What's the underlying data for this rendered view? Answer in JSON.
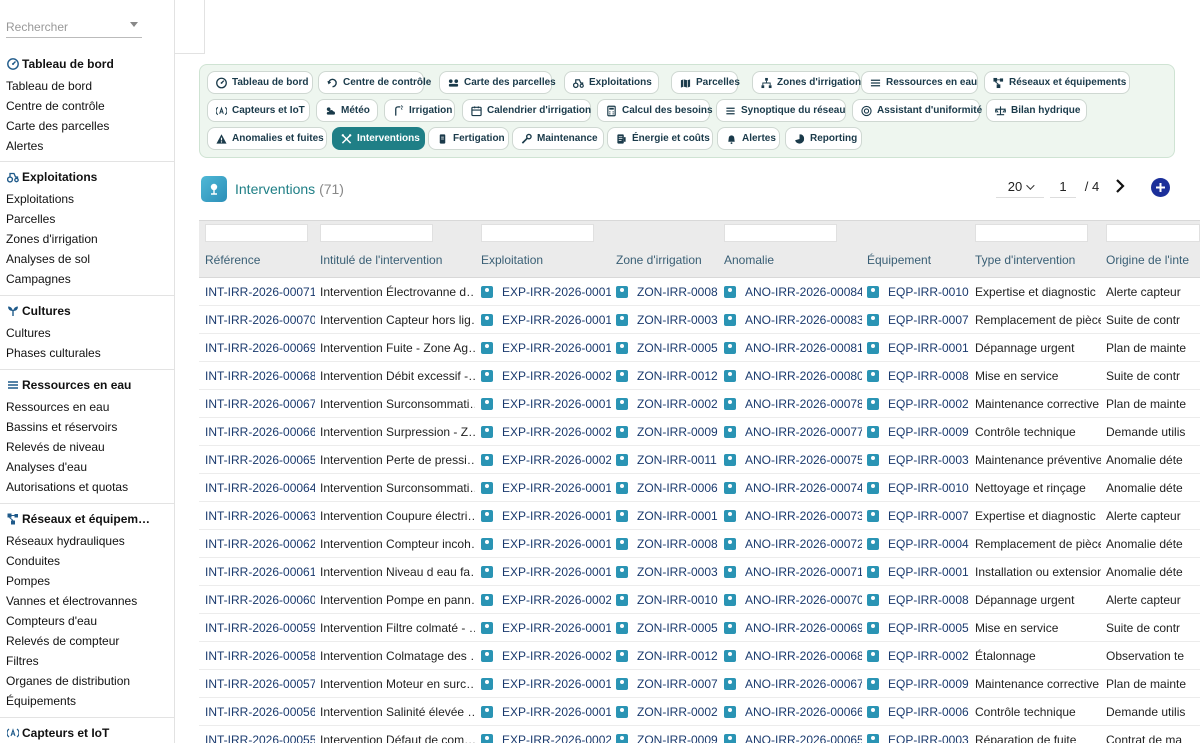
{
  "sidebar": {
    "search_placeholder": "Rechercher",
    "groups": [
      {
        "title": "Tableau de bord",
        "icon": "dashboard-icon",
        "items": [
          "Tableau de bord",
          "Centre de contrôle",
          "Carte des parcelles",
          "Alertes"
        ]
      },
      {
        "title": "Exploitations",
        "icon": "tractor-icon",
        "items": [
          "Exploitations",
          "Parcelles",
          "Zones d'irrigation",
          "Analyses de sol",
          "Campagnes"
        ]
      },
      {
        "title": "Cultures",
        "icon": "sprout-icon",
        "items": [
          "Cultures",
          "Phases culturales"
        ]
      },
      {
        "title": "Ressources en eau",
        "icon": "water-icon",
        "items": [
          "Ressources en eau",
          "Bassins et réservoirs",
          "Relevés de niveau",
          "Analyses d'eau",
          "Autorisations et quotas"
        ]
      },
      {
        "title": "Réseaux et équipem…",
        "icon": "network-icon",
        "items": [
          "Réseaux hydrauliques",
          "Conduites",
          "Pompes",
          "Vannes et électrovannes",
          "Compteurs d'eau",
          "Relevés de compteur",
          "Filtres",
          "Organes de distribution",
          "Équipements"
        ]
      },
      {
        "title": "Capteurs et IoT",
        "icon": "sensor-icon",
        "items": []
      }
    ]
  },
  "tabs": [
    {
      "label": "Tableau de bord",
      "icon": "dashboard-icon",
      "active": false
    },
    {
      "label": "Centre de contrôle",
      "icon": "control-icon",
      "active": false
    },
    {
      "label": "Carte des parcelles",
      "icon": "map-icon",
      "active": false
    },
    {
      "label": "Exploitations",
      "icon": "tractor-icon",
      "active": false
    },
    {
      "label": "Parcelles",
      "icon": "parcel-icon",
      "active": false
    },
    {
      "label": "Zones d'irrigation",
      "icon": "zones-icon",
      "active": false
    },
    {
      "label": "Ressources en eau",
      "icon": "water-icon",
      "active": false
    },
    {
      "label": "Réseaux et équipements",
      "icon": "network-icon",
      "active": false
    },
    {
      "label": "Capteurs et IoT",
      "icon": "sensor-icon",
      "active": false
    },
    {
      "label": "Météo",
      "icon": "weather-icon",
      "active": false
    },
    {
      "label": "Irrigation",
      "icon": "irrigation-icon",
      "active": false
    },
    {
      "label": "Calendrier d'irrigation",
      "icon": "calendar-icon",
      "active": false
    },
    {
      "label": "Calcul des besoins",
      "icon": "calculator-icon",
      "active": false
    },
    {
      "label": "Synoptique du réseau",
      "icon": "synoptic-icon",
      "active": false
    },
    {
      "label": "Assistant d'uniformité",
      "icon": "target-icon",
      "active": false
    },
    {
      "label": "Bilan hydrique",
      "icon": "balance-icon",
      "active": false
    },
    {
      "label": "Anomalies et fuites",
      "icon": "warning-icon",
      "active": false
    },
    {
      "label": "Interventions",
      "icon": "tools-icon",
      "active": true
    },
    {
      "label": "Fertigation",
      "icon": "fertigation-icon",
      "active": false
    },
    {
      "label": "Maintenance",
      "icon": "wrench-icon",
      "active": false
    },
    {
      "label": "Énergie et coûts",
      "icon": "energy-icon",
      "active": false
    },
    {
      "label": "Alertes",
      "icon": "bell-icon",
      "active": false
    },
    {
      "label": "Reporting",
      "icon": "report-icon",
      "active": false
    }
  ],
  "list": {
    "title": "Interventions",
    "count": "(71)",
    "page_size": "20",
    "page": "1",
    "page_of": "/  4"
  },
  "table": {
    "columns": [
      "Référence",
      "Intitulé de l'intervention",
      "Exploitation",
      "Zone d'irrigation",
      "Anomalie",
      "Équipement",
      "Type d'intervention",
      "Origine de l'inte"
    ],
    "rows": [
      [
        "INT-IRR-2026-00071",
        "Intervention Électrovanne d…",
        "EXP-IRR-2026-0001",
        "ZON-IRR-0008",
        "ANO-IRR-2026-00084",
        "EQP-IRR-0010",
        "Expertise et diagnostic",
        "Alerte capteur"
      ],
      [
        "INT-IRR-2026-00070",
        "Intervention Capteur hors lig…",
        "EXP-IRR-2026-0001",
        "ZON-IRR-0003",
        "ANO-IRR-2026-00083",
        "EQP-IRR-0007",
        "Remplacement de pièce",
        "Suite de contr"
      ],
      [
        "INT-IRR-2026-00069",
        "Intervention Fuite - Zone Ag…",
        "EXP-IRR-2026-0001",
        "ZON-IRR-0005",
        "ANO-IRR-2026-00081",
        "EQP-IRR-0001",
        "Dépannage urgent",
        "Plan de mainte"
      ],
      [
        "INT-IRR-2026-00068",
        "Intervention Débit excessif -…",
        "EXP-IRR-2026-0002",
        "ZON-IRR-0012",
        "ANO-IRR-2026-00080",
        "EQP-IRR-0008",
        "Mise en service",
        "Suite de contr"
      ],
      [
        "INT-IRR-2026-00067",
        "Intervention Surconsommati…",
        "EXP-IRR-2026-0001",
        "ZON-IRR-0002",
        "ANO-IRR-2026-00078",
        "EQP-IRR-0002",
        "Maintenance corrective",
        "Plan de mainte"
      ],
      [
        "INT-IRR-2026-00066",
        "Intervention Surpression - Z…",
        "EXP-IRR-2026-0002",
        "ZON-IRR-0009",
        "ANO-IRR-2026-00077",
        "EQP-IRR-0009",
        "Contrôle technique",
        "Demande utilis"
      ],
      [
        "INT-IRR-2026-00065",
        "Intervention Perte de pressi…",
        "EXP-IRR-2026-0002",
        "ZON-IRR-0011",
        "ANO-IRR-2026-00075",
        "EQP-IRR-0003",
        "Maintenance préventive",
        "Anomalie déte"
      ],
      [
        "INT-IRR-2026-00064",
        "Intervention Surconsommati…",
        "EXP-IRR-2026-0001",
        "ZON-IRR-0006",
        "ANO-IRR-2026-00074",
        "EQP-IRR-0010",
        "Nettoyage et rinçage",
        "Anomalie déte"
      ],
      [
        "INT-IRR-2026-00063",
        "Intervention Coupure électri…",
        "EXP-IRR-2026-0001",
        "ZON-IRR-0001",
        "ANO-IRR-2026-00073",
        "EQP-IRR-0007",
        "Expertise et diagnostic",
        "Alerte capteur"
      ],
      [
        "INT-IRR-2026-00062",
        "Intervention Compteur incoh…",
        "EXP-IRR-2026-0001",
        "ZON-IRR-0008",
        "ANO-IRR-2026-00072",
        "EQP-IRR-0004",
        "Remplacement de pièce",
        "Anomalie déte"
      ],
      [
        "INT-IRR-2026-00061",
        "Intervention Niveau d eau fa…",
        "EXP-IRR-2026-0001",
        "ZON-IRR-0003",
        "ANO-IRR-2026-00071",
        "EQP-IRR-0001",
        "Installation ou extension",
        "Anomalie déte"
      ],
      [
        "INT-IRR-2026-00060",
        "Intervention Pompe en pann…",
        "EXP-IRR-2026-0002",
        "ZON-IRR-0010",
        "ANO-IRR-2026-00070",
        "EQP-IRR-0008",
        "Dépannage urgent",
        "Alerte capteur"
      ],
      [
        "INT-IRR-2026-00059",
        "Intervention Filtre colmaté - …",
        "EXP-IRR-2026-0001",
        "ZON-IRR-0005",
        "ANO-IRR-2026-00069",
        "EQP-IRR-0005",
        "Mise en service",
        "Suite de contr"
      ],
      [
        "INT-IRR-2026-00058",
        "Intervention Colmatage des …",
        "EXP-IRR-2026-0002",
        "ZON-IRR-0012",
        "ANO-IRR-2026-00068",
        "EQP-IRR-0002",
        "Étalonnage",
        "Observation te"
      ],
      [
        "INT-IRR-2026-00057",
        "Intervention Moteur en surc…",
        "EXP-IRR-2026-0001",
        "ZON-IRR-0007",
        "ANO-IRR-2026-00067",
        "EQP-IRR-0009",
        "Maintenance corrective",
        "Plan de mainte"
      ],
      [
        "INT-IRR-2026-00056",
        "Intervention Salinité élevée …",
        "EXP-IRR-2026-0001",
        "ZON-IRR-0002",
        "ANO-IRR-2026-00066",
        "EQP-IRR-0006",
        "Contrôle technique",
        "Demande utilis"
      ],
      [
        "INT-IRR-2026-00055",
        "Intervention Défaut de com…",
        "EXP-IRR-2026-0002",
        "ZON-IRR-0009",
        "ANO-IRR-2026-00065",
        "EQP-IRR-0003",
        "Réparation de fuite",
        "Contrat de ma"
      ]
    ]
  }
}
